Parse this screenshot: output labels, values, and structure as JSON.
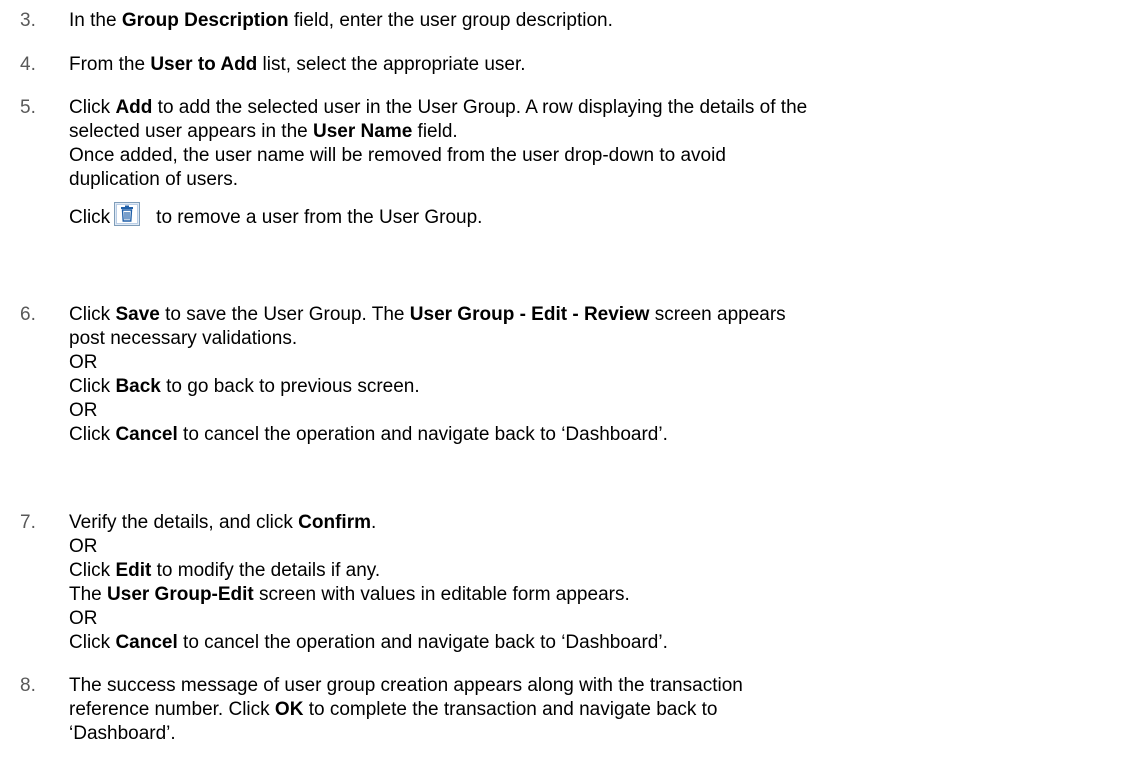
{
  "steps": [
    {
      "number": "3.",
      "lines": [
        [
          {
            "t": "In the "
          },
          {
            "t": "Group Description",
            "b": true
          },
          {
            "t": " field, enter the user group description."
          }
        ]
      ]
    },
    {
      "number": "4.",
      "lines": [
        [
          {
            "t": "From the "
          },
          {
            "t": "User to Add",
            "b": true
          },
          {
            "t": " list, select the appropriate user."
          }
        ]
      ]
    },
    {
      "number": "5.",
      "lines": [
        [
          {
            "t": "Click "
          },
          {
            "t": "Add",
            "b": true
          },
          {
            "t": " to add the selected user in the User Group. A row displaying the details of the"
          }
        ],
        [
          {
            "t": "selected user appears in the "
          },
          {
            "t": "User Name",
            "b": true
          },
          {
            "t": " field."
          }
        ],
        [
          {
            "t": "Once added, the user name will be removed from the user drop-down to avoid"
          }
        ],
        [
          {
            "t": "duplication of users."
          }
        ],
        [
          {
            "t": "Click"
          },
          {
            "icon": "trash-icon"
          },
          {
            "t": "to remove a user from the User Group."
          }
        ]
      ]
    },
    {
      "number": "6.",
      "lines": [
        [
          {
            "t": "Click "
          },
          {
            "t": "Save",
            "b": true
          },
          {
            "t": " to save the User Group. The "
          },
          {
            "t": "User Group - Edit - Review",
            "b": true
          },
          {
            "t": " screen appears"
          }
        ],
        [
          {
            "t": "post necessary validations."
          }
        ],
        [
          {
            "t": "OR"
          }
        ],
        [
          {
            "t": "Click "
          },
          {
            "t": "Back",
            "b": true
          },
          {
            "t": " to go back to previous screen."
          }
        ],
        [
          {
            "t": "OR"
          }
        ],
        [
          {
            "t": "Click "
          },
          {
            "t": "Cancel",
            "b": true
          },
          {
            "t": " to cancel the operation and navigate back to ‘Dashboard’."
          }
        ]
      ]
    },
    {
      "number": "7.",
      "lines": [
        [
          {
            "t": "Verify the details, and click "
          },
          {
            "t": "Confirm",
            "b": true
          },
          {
            "t": "."
          }
        ],
        [
          {
            "t": "OR"
          }
        ],
        [
          {
            "t": "Click "
          },
          {
            "t": "Edit",
            "b": true
          },
          {
            "t": " to modify the details if any."
          }
        ],
        [
          {
            "t": "The "
          },
          {
            "t": "User Group-Edit",
            "b": true
          },
          {
            "t": " screen with values in editable form appears."
          }
        ],
        [
          {
            "t": "OR"
          }
        ],
        [
          {
            "t": "Click "
          },
          {
            "t": "Cancel",
            "b": true
          },
          {
            "t": " to cancel the operation and navigate back to ‘Dashboard’."
          }
        ]
      ]
    },
    {
      "number": "8.",
      "lines": [
        [
          {
            "t": "The success message of user group creation appears along with the transaction"
          }
        ],
        [
          {
            "t": "reference number. Click "
          },
          {
            "t": "OK",
            "b": true
          },
          {
            "t": " to complete the transaction and navigate back to"
          }
        ],
        [
          {
            "t": "‘Dashboard’."
          }
        ]
      ]
    }
  ]
}
